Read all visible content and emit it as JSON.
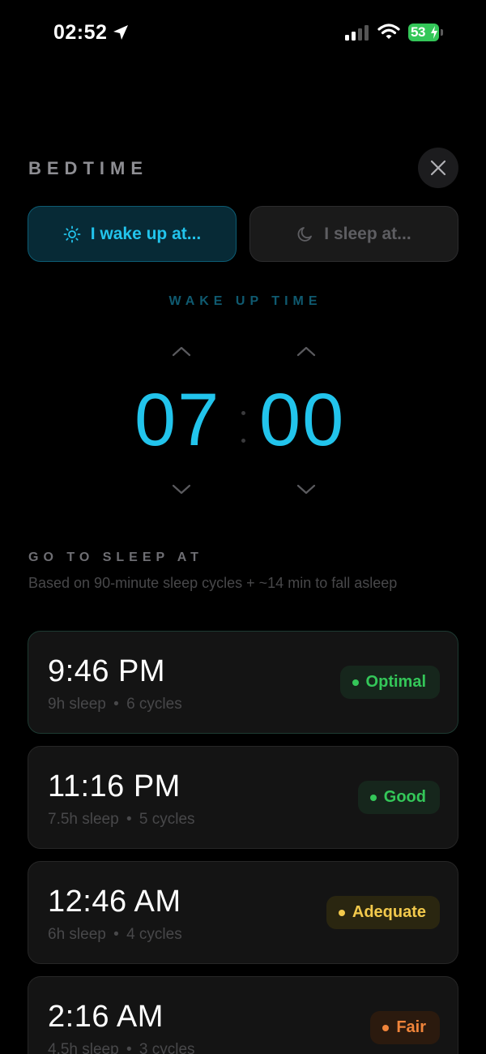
{
  "status_bar": {
    "time": "02:52",
    "battery": "53"
  },
  "header": {
    "title": "BEDTIME"
  },
  "mode_toggle": {
    "wake_label": "I wake up at...",
    "sleep_label": "I sleep at...",
    "selected": "wake"
  },
  "picker": {
    "label": "WAKE UP TIME",
    "hour": "07",
    "minute": "00"
  },
  "sleep_section": {
    "title": "GO TO SLEEP AT",
    "description": "Based on 90-minute sleep cycles + ~14 min to fall asleep"
  },
  "options": [
    {
      "time": "9:46 PM",
      "duration": "9h sleep",
      "cycles": "6 cycles",
      "rating": "Optimal"
    },
    {
      "time": "11:16 PM",
      "duration": "7.5h sleep",
      "cycles": "5 cycles",
      "rating": "Good"
    },
    {
      "time": "12:46 AM",
      "duration": "6h sleep",
      "cycles": "4 cycles",
      "rating": "Adequate"
    },
    {
      "time": "2:16 AM",
      "duration": "4.5h sleep",
      "cycles": "3 cycles",
      "rating": "Fair"
    }
  ],
  "meta_separator": "•",
  "colors": {
    "accent": "#22c4ec",
    "optimal": "#34c759",
    "good": "#34c759",
    "adequate": "#f2c94c",
    "fair": "#f0843a"
  },
  "icons": [
    "location-arrow-icon",
    "signal-icon",
    "wifi-icon",
    "battery-icon",
    "close-icon",
    "sun-icon",
    "moon-icon",
    "chevron-up-icon",
    "chevron-down-icon"
  ]
}
